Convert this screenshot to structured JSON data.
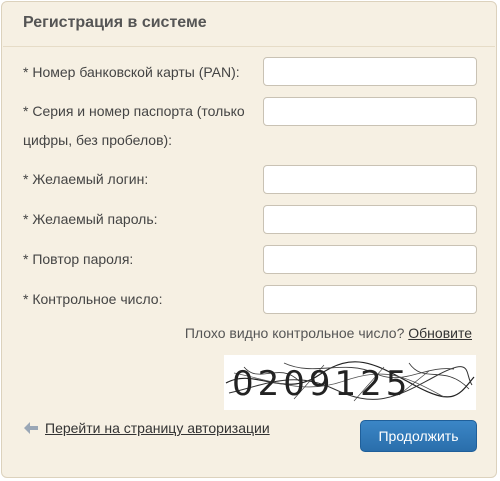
{
  "form": {
    "title": "Регистрация в системе",
    "fields": {
      "card": {
        "label": "* Номер банковской карты (PAN):",
        "value": ""
      },
      "passport": {
        "label_line1": "* Серия и номер паспорта (только",
        "label_line2": "цифры, без пробелов):",
        "value": ""
      },
      "login": {
        "label": "* Желаемый логин:",
        "value": ""
      },
      "password": {
        "label": "* Желаемый пароль:",
        "value": ""
      },
      "password_repeat": {
        "label": "* Повтор пароля:",
        "value": ""
      },
      "captcha": {
        "label": "* Контрольное число:",
        "value": ""
      }
    },
    "captcha_refresh": {
      "question": "Плохо видно контрольное число?",
      "link": "Обновите",
      "image_text": "0209125"
    },
    "back_link": "Перейти на страницу авторизации",
    "submit_label": "Продолжить"
  },
  "colors": {
    "panel_bg": "#f6f0e3",
    "button": "#2f78b8"
  },
  "icons": {
    "back": "arrow-left-icon"
  }
}
